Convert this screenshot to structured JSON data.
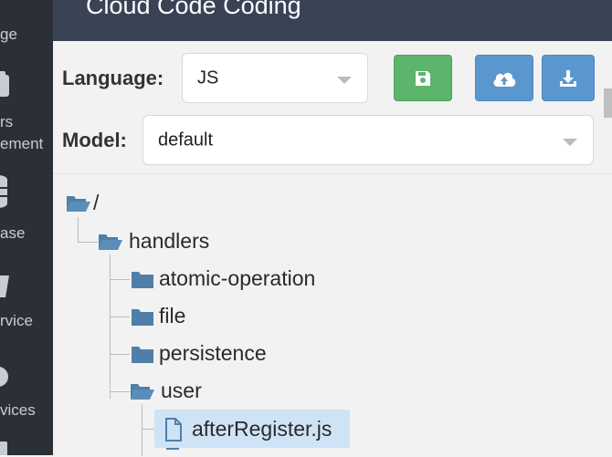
{
  "sidebar": {
    "items": [
      {
        "label": "ge"
      },
      {
        "label": "rs"
      },
      {
        "label": "ement"
      },
      {
        "label": "ase"
      },
      {
        "label": "rvice"
      },
      {
        "label": "vices"
      }
    ]
  },
  "header": {
    "title": "Cloud Code Coding"
  },
  "toolbar": {
    "language_label": "Language:",
    "language_value": "JS",
    "model_label": "Model:",
    "model_value": "default",
    "save_icon": "save-icon",
    "upload_icon": "cloud-upload-icon",
    "download_icon": "download-icon",
    "colors": {
      "green": "#5cb56b",
      "blue": "#5b97cf"
    }
  },
  "tree": {
    "root": "/",
    "handlers": "handlers",
    "atomic_operation": "atomic-operation",
    "file": "file",
    "persistence": "persistence",
    "user": "user",
    "after_register": "afterRegister.js"
  }
}
